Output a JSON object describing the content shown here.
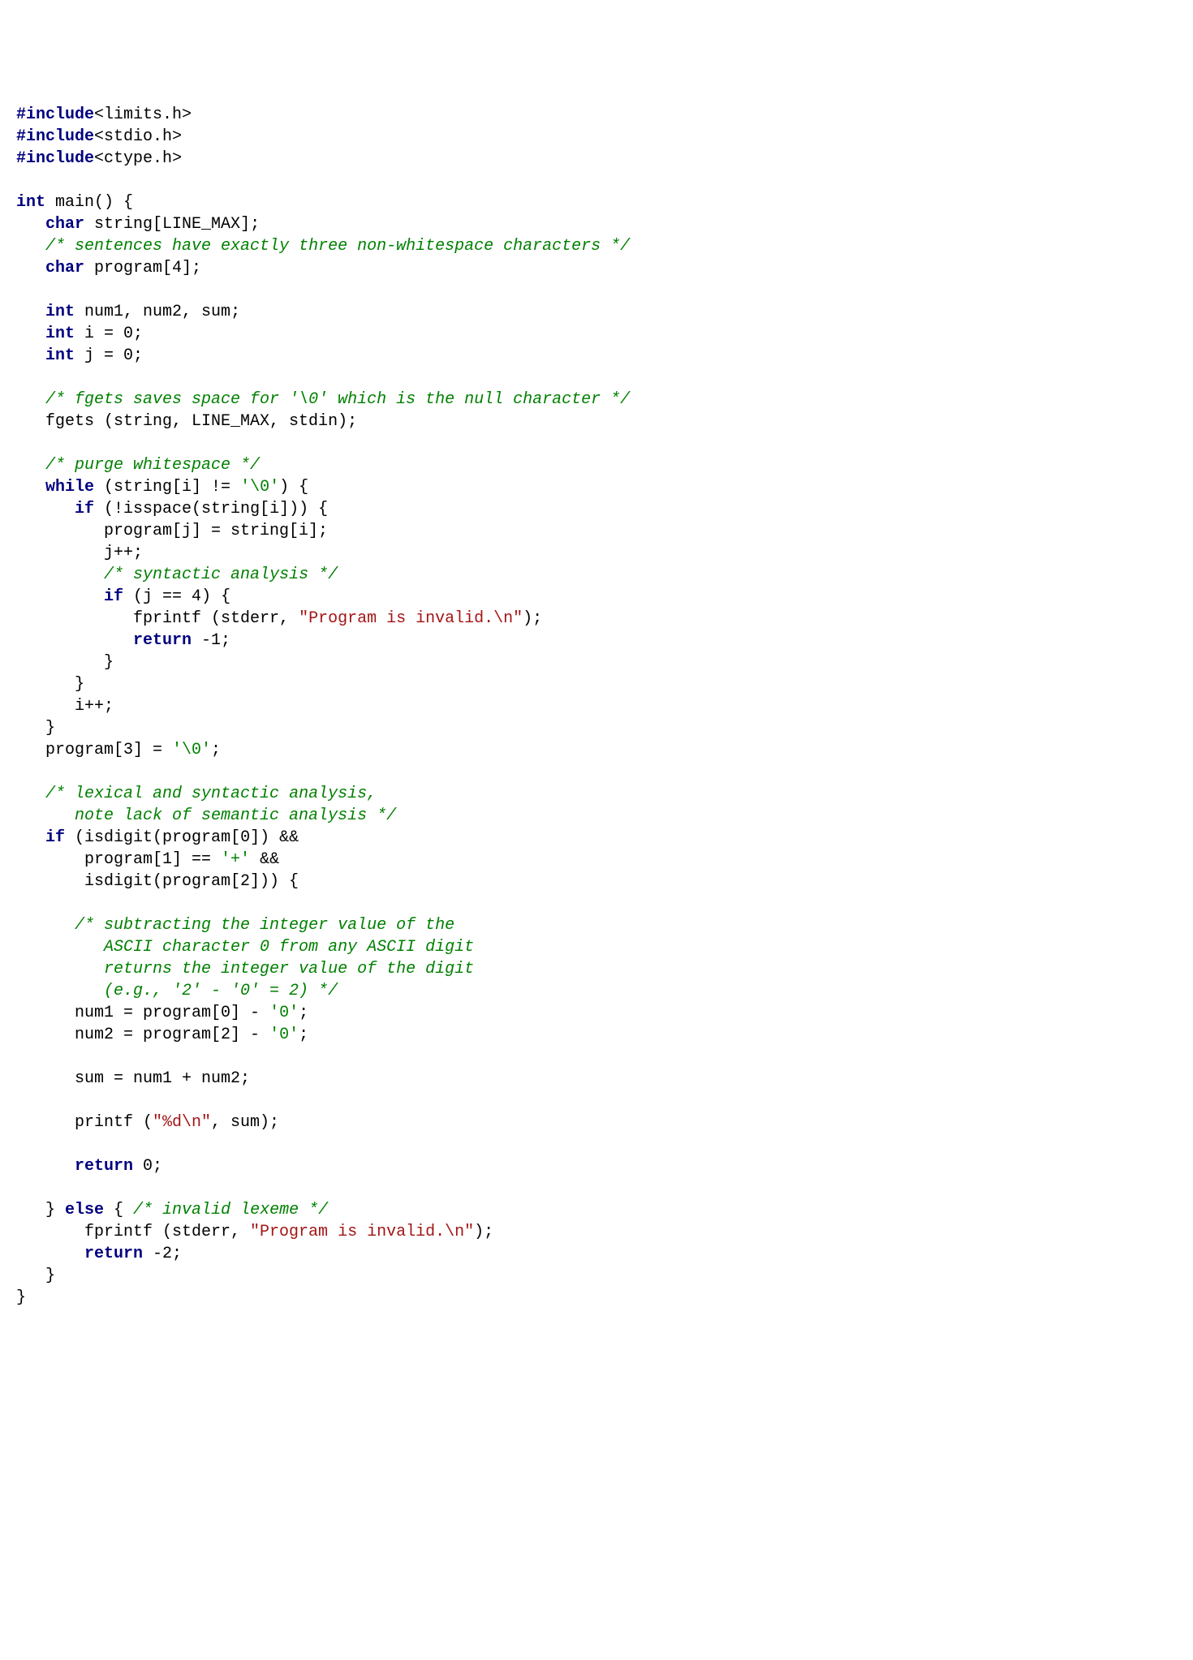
{
  "code": {
    "lines": [
      [
        {
          "t": "#include",
          "c": "kw"
        },
        {
          "t": "<limits.h>",
          "c": ""
        }
      ],
      [
        {
          "t": "#include",
          "c": "kw"
        },
        {
          "t": "<stdio.h>",
          "c": ""
        }
      ],
      [
        {
          "t": "#include",
          "c": "kw"
        },
        {
          "t": "<ctype.h>",
          "c": ""
        }
      ],
      [],
      [
        {
          "t": "int",
          "c": "kw"
        },
        {
          "t": " main() {",
          "c": ""
        }
      ],
      [
        {
          "t": "   ",
          "c": ""
        },
        {
          "t": "char",
          "c": "kw"
        },
        {
          "t": " string[LINE_MAX];",
          "c": ""
        }
      ],
      [
        {
          "t": "   ",
          "c": ""
        },
        {
          "t": "/* sentences have exactly three non-whitespace characters */",
          "c": "cm"
        }
      ],
      [
        {
          "t": "   ",
          "c": ""
        },
        {
          "t": "char",
          "c": "kw"
        },
        {
          "t": " program[4];",
          "c": ""
        }
      ],
      [],
      [
        {
          "t": "   ",
          "c": ""
        },
        {
          "t": "int",
          "c": "kw"
        },
        {
          "t": " num1, num2, sum;",
          "c": ""
        }
      ],
      [
        {
          "t": "   ",
          "c": ""
        },
        {
          "t": "int",
          "c": "kw"
        },
        {
          "t": " i = 0;",
          "c": ""
        }
      ],
      [
        {
          "t": "   ",
          "c": ""
        },
        {
          "t": "int",
          "c": "kw"
        },
        {
          "t": " j = 0;",
          "c": ""
        }
      ],
      [],
      [
        {
          "t": "   ",
          "c": ""
        },
        {
          "t": "/* fgets saves space for '\\0' which is the null character */",
          "c": "cm"
        }
      ],
      [
        {
          "t": "   fgets (string, LINE_MAX, stdin);",
          "c": ""
        }
      ],
      [],
      [
        {
          "t": "   ",
          "c": ""
        },
        {
          "t": "/* purge whitespace */",
          "c": "cm"
        }
      ],
      [
        {
          "t": "   ",
          "c": ""
        },
        {
          "t": "while",
          "c": "kw"
        },
        {
          "t": " (string[i] != ",
          "c": ""
        },
        {
          "t": "'\\0'",
          "c": "ch"
        },
        {
          "t": ") {",
          "c": ""
        }
      ],
      [
        {
          "t": "      ",
          "c": ""
        },
        {
          "t": "if",
          "c": "kw"
        },
        {
          "t": " (!isspace(string[i])) {",
          "c": ""
        }
      ],
      [
        {
          "t": "         program[j] = string[i];",
          "c": ""
        }
      ],
      [
        {
          "t": "         j++;",
          "c": ""
        }
      ],
      [
        {
          "t": "         ",
          "c": ""
        },
        {
          "t": "/* syntactic analysis */",
          "c": "cm"
        }
      ],
      [
        {
          "t": "         ",
          "c": ""
        },
        {
          "t": "if",
          "c": "kw"
        },
        {
          "t": " (j == 4) {",
          "c": ""
        }
      ],
      [
        {
          "t": "            fprintf (stderr, ",
          "c": ""
        },
        {
          "t": "\"Program is invalid.\\n\"",
          "c": "st"
        },
        {
          "t": ");",
          "c": ""
        }
      ],
      [
        {
          "t": "            ",
          "c": ""
        },
        {
          "t": "return",
          "c": "kw"
        },
        {
          "t": " -1;",
          "c": ""
        }
      ],
      [
        {
          "t": "         }",
          "c": ""
        }
      ],
      [
        {
          "t": "      }",
          "c": ""
        }
      ],
      [
        {
          "t": "      i++;",
          "c": ""
        }
      ],
      [
        {
          "t": "   }",
          "c": ""
        }
      ],
      [
        {
          "t": "   program[3] = ",
          "c": ""
        },
        {
          "t": "'\\0'",
          "c": "ch"
        },
        {
          "t": ";",
          "c": ""
        }
      ],
      [],
      [
        {
          "t": "   ",
          "c": ""
        },
        {
          "t": "/* lexical and syntactic analysis,",
          "c": "cm"
        }
      ],
      [
        {
          "t": "      note lack of semantic analysis */",
          "c": "cm"
        }
      ],
      [
        {
          "t": "   ",
          "c": ""
        },
        {
          "t": "if",
          "c": "kw"
        },
        {
          "t": " (isdigit(program[0]) &&",
          "c": ""
        }
      ],
      [
        {
          "t": "       program[1] == ",
          "c": ""
        },
        {
          "t": "'+'",
          "c": "ch"
        },
        {
          "t": " &&",
          "c": ""
        }
      ],
      [
        {
          "t": "       isdigit(program[2])) {",
          "c": ""
        }
      ],
      [],
      [
        {
          "t": "      ",
          "c": ""
        },
        {
          "t": "/* subtracting the integer value of the",
          "c": "cm"
        }
      ],
      [
        {
          "t": "         ASCII character 0 from any ASCII digit",
          "c": "cm"
        }
      ],
      [
        {
          "t": "         returns the integer value of the digit",
          "c": "cm"
        }
      ],
      [
        {
          "t": "         (e.g., '2' - '0' = 2) */",
          "c": "cm"
        }
      ],
      [
        {
          "t": "      num1 = program[0] - ",
          "c": ""
        },
        {
          "t": "'0'",
          "c": "ch"
        },
        {
          "t": ";",
          "c": ""
        }
      ],
      [
        {
          "t": "      num2 = program[2] - ",
          "c": ""
        },
        {
          "t": "'0'",
          "c": "ch"
        },
        {
          "t": ";",
          "c": ""
        }
      ],
      [],
      [
        {
          "t": "      sum = num1 + num2;",
          "c": ""
        }
      ],
      [],
      [
        {
          "t": "      printf (",
          "c": ""
        },
        {
          "t": "\"%d\\n\"",
          "c": "st"
        },
        {
          "t": ", sum);",
          "c": ""
        }
      ],
      [],
      [
        {
          "t": "      ",
          "c": ""
        },
        {
          "t": "return",
          "c": "kw"
        },
        {
          "t": " 0;",
          "c": ""
        }
      ],
      [],
      [
        {
          "t": "   } ",
          "c": ""
        },
        {
          "t": "else",
          "c": "kw"
        },
        {
          "t": " { ",
          "c": ""
        },
        {
          "t": "/* invalid lexeme */",
          "c": "cm"
        }
      ],
      [
        {
          "t": "       fprintf (stderr, ",
          "c": ""
        },
        {
          "t": "\"Program is invalid.\\n\"",
          "c": "st"
        },
        {
          "t": ");",
          "c": ""
        }
      ],
      [
        {
          "t": "       ",
          "c": ""
        },
        {
          "t": "return",
          "c": "kw"
        },
        {
          "t": " -2;",
          "c": ""
        }
      ],
      [
        {
          "t": "   }",
          "c": ""
        }
      ],
      [
        {
          "t": "}",
          "c": ""
        }
      ]
    ]
  }
}
